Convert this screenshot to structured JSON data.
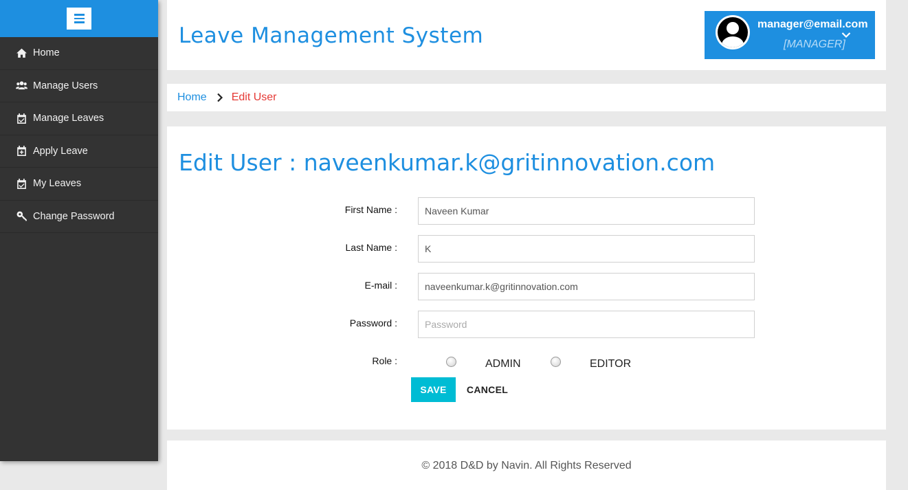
{
  "sidebar": {
    "menu_icon": "hamburger-menu-icon",
    "items": [
      {
        "label": "Home",
        "icon": "home-icon"
      },
      {
        "label": "Manage Users",
        "icon": "users-icon"
      },
      {
        "label": "Manage Leaves",
        "icon": "calendar-check-icon"
      },
      {
        "label": "Apply Leave",
        "icon": "calendar-plus-icon"
      },
      {
        "label": "My Leaves",
        "icon": "calendar-check-icon"
      },
      {
        "label": "Change Password",
        "icon": "key-icon"
      }
    ]
  },
  "header": {
    "title": "Leave Management System",
    "user": {
      "email": "manager@email.com",
      "role": "[MANAGER]",
      "avatar_icon": "user-avatar-icon",
      "dropdown_icon": "chevron-down-icon"
    }
  },
  "breadcrumb": {
    "home": "Home",
    "current": "Edit User"
  },
  "form": {
    "title": "Edit User : naveenkumar.k@gritinnovation.com",
    "first_name": {
      "label": "First Name :",
      "value": "Naveen Kumar"
    },
    "last_name": {
      "label": "Last Name :",
      "value": "K"
    },
    "email": {
      "label": "E-mail :",
      "value": "naveenkumar.k@gritinnovation.com"
    },
    "password": {
      "label": "Password :",
      "value": "",
      "placeholder": "Password"
    },
    "role": {
      "label": "Role :",
      "options": [
        "ADMIN",
        "EDITOR"
      ],
      "selected": null
    },
    "save_label": "SAVE",
    "cancel_label": "CANCEL"
  },
  "footer": {
    "text": "© 2018 D&D by Navin. All Rights Reserved"
  },
  "colors": {
    "primary": "#1e8fe0",
    "sidebar_bg": "#333333",
    "breadcrumb_current": "#e53935",
    "save_button": "#00bcd4",
    "page_bg": "#e9e9e9"
  }
}
